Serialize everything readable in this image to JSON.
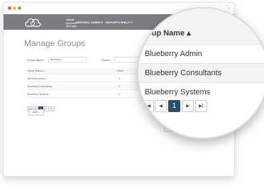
{
  "app": {
    "brand_line1": "Cloud",
    "brand_line2": "Machine",
    "brand_line3": "Manager"
  },
  "nav": {
    "items": [
      {
        "label": "SERVERS"
      },
      {
        "label": "ADMIN ▾"
      },
      {
        "label": "REPORTS ▾"
      },
      {
        "label": "HELP ▾"
      }
    ],
    "welcome": "Welco..."
  },
  "page": {
    "title": "Manage Groups",
    "filter_group_name_label": "Group Name",
    "filter_group_name_value": "Blueberry",
    "filter_owner_label": "Owner"
  },
  "table": {
    "columns": [
      "Group Name ▴",
      "Users"
    ],
    "rows": [
      {
        "name": "Blueberry Admin",
        "users": "1"
      },
      {
        "name": "Blueberry Consultants",
        "users": "2"
      },
      {
        "name": "Blueberry Systems",
        "users": "0"
      }
    ],
    "add_label": "Add..."
  },
  "pager": {
    "first": "|◀",
    "prev": "◀",
    "current": "1",
    "next": "▶",
    "last": "▶|"
  },
  "magnifier": {
    "header": "oup Name ▴",
    "rows": [
      "Blueberry Admin",
      "Blueberry Consultants",
      "Blueberry Systems"
    ]
  },
  "colors": {
    "navbar": "#7c7d80",
    "pager_active": "#2f4d63",
    "dot_red": "#ee5c55",
    "dot_yellow": "#f6be33",
    "dot_green": "#5fc551"
  }
}
